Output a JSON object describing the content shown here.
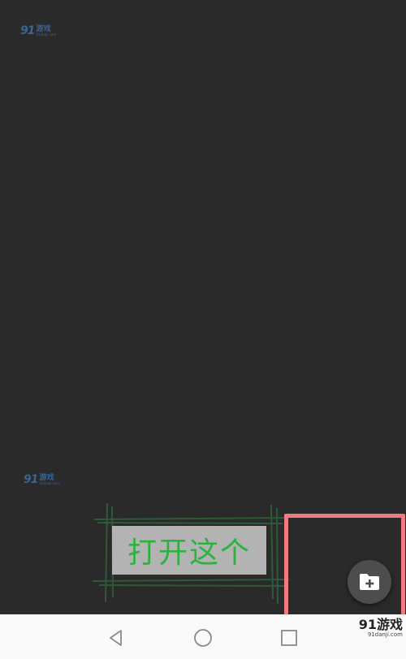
{
  "watermark": {
    "brand_num": "91",
    "brand_cn": "游戏",
    "brand_url": "91danji.com",
    "color": "#3f6fa8"
  },
  "callout": {
    "label": "打开这个",
    "text_color": "#2db23f",
    "label_bg": "#b3b3b3",
    "line_color": "#2f5a3a"
  },
  "highlight": {
    "border_color": "#f07a7e"
  },
  "fab": {
    "icon": "folder-plus-icon",
    "background": "#4d4d4d"
  },
  "nav_bar": {
    "back_icon": "back-triangle-icon",
    "home_icon": "home-circle-icon",
    "recent_icon": "recent-square-icon"
  },
  "corner_logo": {
    "main": "91游戏",
    "url": "91danji.com"
  },
  "colors": {
    "background": "#2a2a2a",
    "nav_bg": "#fafafa"
  }
}
